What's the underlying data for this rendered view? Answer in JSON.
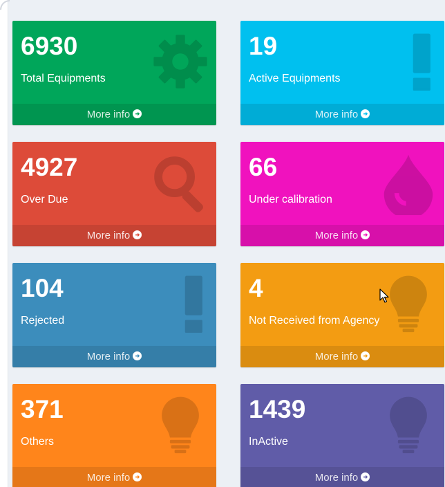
{
  "colors": {
    "page_bg": "#ecf0f5",
    "green": "#00a65a",
    "aqua": "#00c0ef",
    "red": "#dd4b39",
    "fuchsia": "#f012be",
    "blue": "#3c8dbc",
    "yellow": "#f39c12",
    "orange": "#ff851b",
    "purple": "#605ca8"
  },
  "boxes": [
    {
      "count": "6930",
      "label": "Total Equipments",
      "footer": "More info",
      "icon": "gear-icon",
      "color": "#00a65a"
    },
    {
      "count": "19",
      "label": "Active Equipments",
      "footer": "More info",
      "icon": "exclamation-icon",
      "color": "#00c0ef"
    },
    {
      "count": "4927",
      "label": "Over Due",
      "footer": "More info",
      "icon": "search-icon",
      "color": "#dd4b39"
    },
    {
      "count": "66",
      "label": "Under calibration",
      "footer": "More info",
      "icon": "tint-icon",
      "color": "#f012be"
    },
    {
      "count": "104",
      "label": "Rejected",
      "footer": "More info",
      "icon": "exclamation-icon",
      "color": "#3c8dbc"
    },
    {
      "count": "4",
      "label": "Not Received from Agency",
      "footer": "More info",
      "icon": "lightbulb-icon",
      "color": "#f39c12"
    },
    {
      "count": "371",
      "label": "Others",
      "footer": "More info",
      "icon": "lightbulb-icon",
      "color": "#ff851b"
    },
    {
      "count": "1439",
      "label": "InActive",
      "footer": "More info",
      "icon": "lightbulb-icon",
      "color": "#605ca8"
    }
  ]
}
